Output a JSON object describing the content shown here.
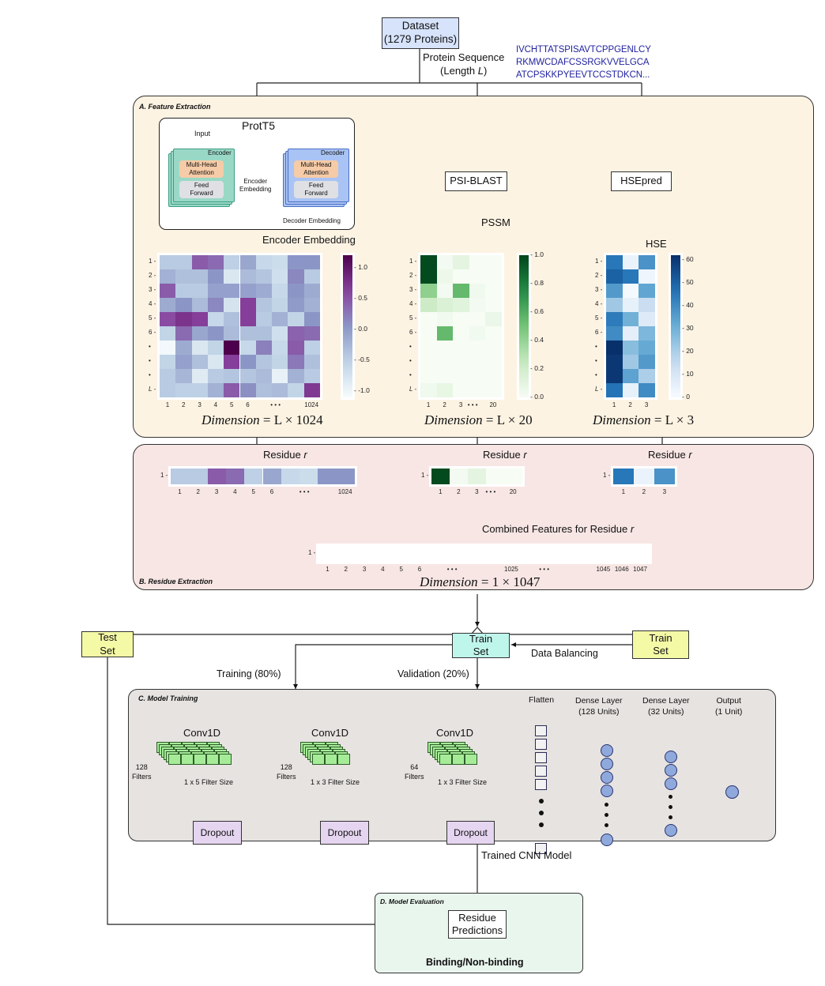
{
  "dataset": {
    "title": "Dataset",
    "subtitle": "(1279 Proteins)"
  },
  "protein_sequence": {
    "label": "Protein Sequence",
    "length_label": "(Length ",
    "length_var": "L",
    "length_close": ")"
  },
  "sequence_lines": [
    "IVCHTTATSPISAVTCPPGENLCY",
    "RKMWCDAFCSSRGKVVELGCA",
    "ATCPSKKPYEEVTCCSTDKCN..."
  ],
  "panel_a": {
    "title": "A. Feature Extraction",
    "prott5": {
      "title": "ProtT5",
      "input": "Input",
      "encoder": "Encoder",
      "decoder": "Decoder",
      "attention": "Multi-Head Attention",
      "attention_l1": "Multi-Head",
      "attention_l2": "Attention",
      "ff_l1": "Feed",
      "ff_l2": "Forward",
      "enc_emb_l1": "Encoder",
      "enc_emb_l2": "Embedding",
      "dec_emb": "Decoder Embedding"
    },
    "encoder_embedding_label": "Encoder Embedding",
    "psiblast": "PSI-BLAST",
    "pssm_label": "PSSM",
    "hsepred": "HSEpred",
    "hse_label": "HSE",
    "dim_encoder": {
      "prefix": "Dimension",
      "eq": "= L × 1024"
    },
    "dim_pssm": {
      "prefix": "Dimension",
      "eq": "= L × 20"
    },
    "dim_hse": {
      "prefix": "Dimension",
      "eq": "= L × 3"
    }
  },
  "panel_b": {
    "title": "B. Residue Extraction",
    "residue_label": "Residue ",
    "residue_var": "r",
    "combined_label": "Combined Features for Residue ",
    "combined_var": "r",
    "concat_symbol": "⊕",
    "dim_combined": {
      "prefix": "Dimension",
      "eq": "= 1 × 1047"
    }
  },
  "split": {
    "test_set": {
      "l1": "Test",
      "l2": "Set"
    },
    "train_set_balanced": {
      "l1": "Train",
      "l2": "Set"
    },
    "train_set_raw": {
      "l1": "Train",
      "l2": "Set"
    },
    "data_balancing": "Data Balancing",
    "training": "Training (80%)",
    "validation": "Validation (20%)"
  },
  "panel_c": {
    "title": "C. Model Training",
    "conv_blocks": [
      {
        "title": "Conv1D",
        "filters": "128",
        "filters_label": "Filters",
        "size": "1 x 5 Filter Size",
        "dropout": "Dropout"
      },
      {
        "title": "Conv1D",
        "filters": "128",
        "filters_label": "Filters",
        "size": "1 x 3 Filter Size",
        "dropout": "Dropout"
      },
      {
        "title": "Conv1D",
        "filters": "64",
        "filters_label": "Filters",
        "size": "1 x 3 Filter Size",
        "dropout": "Dropout"
      }
    ],
    "flatten": "Flatten",
    "dense1": {
      "l1": "Dense Layer",
      "l2": "(128 Units)"
    },
    "dense2": {
      "l1": "Dense Layer",
      "l2": "(32 Units)"
    },
    "output": {
      "l1": "Output",
      "l2": "(1 Unit)"
    }
  },
  "trained_model_label": "Trained CNN Model",
  "panel_d": {
    "title": "D. Model Evaluation",
    "predictions_l1": "Residue",
    "predictions_l2": "Predictions",
    "result": "Binding/Non-binding"
  },
  "colors": {
    "dataset_fill": "#d6e3fb",
    "panel_a_fill": "#fdf3e3",
    "panel_b_fill": "#f7e6e4",
    "panel_c_fill": "#e6e3e1",
    "panel_d_fill": "#e9f6ee",
    "test_set_fill": "#f4f9a6",
    "train_set_fill": "#bff6ec",
    "dropout_fill": "#e5d5f0",
    "encoder_fill": "#9ad8c6",
    "decoder_fill": "#a9c3f4",
    "attention_fill": "#f6cba7",
    "ff_fill": "#dfe0e4",
    "filter_fill": "#a6ec98"
  },
  "heatmaps": {
    "encoder": {
      "row_labels": [
        "1",
        "2",
        "3",
        "4",
        "5",
        "6",
        "•",
        "•",
        "•",
        "L"
      ],
      "col_labels": [
        "1",
        "2",
        "3",
        "4",
        "5",
        "6",
        "",
        "• • •",
        "",
        "1024"
      ],
      "colorbar_ticks": [
        "1.0",
        "0.5",
        "0.0",
        "-0.5",
        "-1.0"
      ],
      "range": [
        -1.1,
        1.2
      ],
      "values": [
        [
          -0.45,
          -0.45,
          0.45,
          0.35,
          -0.5,
          -0.1,
          -0.6,
          -0.65,
          0.05,
          0.05
        ],
        [
          -0.2,
          -0.35,
          -0.35,
          0.05,
          -0.8,
          -0.3,
          -0.4,
          -0.7,
          0.15,
          -0.45
        ],
        [
          0.45,
          -0.45,
          -0.45,
          -0.05,
          -0.05,
          -0.05,
          -0.15,
          -0.6,
          0.05,
          -0.15
        ],
        [
          -0.15,
          0.05,
          -0.3,
          0.15,
          -0.75,
          0.65,
          -0.4,
          -0.55,
          0.0,
          -0.2
        ],
        [
          0.55,
          0.75,
          0.65,
          -0.6,
          -0.35,
          0.65,
          -0.45,
          -0.2,
          -0.55,
          0.05
        ],
        [
          -0.55,
          0.35,
          -0.1,
          0.05,
          -0.3,
          -0.35,
          -0.35,
          -0.7,
          0.4,
          0.35
        ],
        [
          -1.05,
          -0.15,
          -0.8,
          -0.55,
          1.2,
          -0.6,
          0.2,
          -0.6,
          0.45,
          -0.5
        ],
        [
          -0.55,
          -0.05,
          -0.35,
          -0.8,
          0.65,
          0.05,
          -0.4,
          -0.55,
          0.25,
          -0.35
        ],
        [
          -0.45,
          -0.25,
          -0.85,
          -0.45,
          -0.4,
          -0.4,
          -0.3,
          -0.95,
          -0.2,
          -0.45
        ],
        [
          -0.45,
          -0.5,
          -0.5,
          -0.2,
          0.45,
          0.1,
          -0.35,
          -0.3,
          -0.55,
          0.7
        ]
      ]
    },
    "pssm": {
      "row_labels": [
        "1",
        "2",
        "3",
        "4",
        "5",
        "6",
        "•",
        "•",
        "•",
        "L"
      ],
      "col_labels": [
        "1",
        "2",
        "3",
        "• • •",
        "20"
      ],
      "colorbar_ticks": [
        "1.0",
        "0.8",
        "0.6",
        "0.4",
        "0.2",
        "0.0"
      ],
      "range": [
        0,
        1
      ],
      "values": [
        [
          0.98,
          0.02,
          0.1,
          0.0,
          0.0
        ],
        [
          0.98,
          0.05,
          0.0,
          0.0,
          0.0
        ],
        [
          0.42,
          0.02,
          0.55,
          0.04,
          0.0
        ],
        [
          0.22,
          0.15,
          0.12,
          0.02,
          0.0
        ],
        [
          0.0,
          0.03,
          0.0,
          0.0,
          0.06
        ],
        [
          0.0,
          0.55,
          0.0,
          0.03,
          0.0
        ],
        [
          0.0,
          0.0,
          0.0,
          0.0,
          0.0
        ],
        [
          0.0,
          0.0,
          0.0,
          0.0,
          0.0
        ],
        [
          0.0,
          0.0,
          0.0,
          0.0,
          0.0
        ],
        [
          0.04,
          0.08,
          0.0,
          0.0,
          0.0
        ]
      ]
    },
    "hse": {
      "row_labels": [
        "1",
        "2",
        "3",
        "4",
        "5",
        "6",
        "•",
        "•",
        "•",
        "L"
      ],
      "col_labels": [
        "1",
        "2",
        "3"
      ],
      "colorbar_ticks": [
        "60",
        "50",
        "40",
        "30",
        "20",
        "10",
        "0"
      ],
      "range": [
        0,
        62
      ],
      "values": [
        [
          45,
          4,
          38
        ],
        [
          50,
          45,
          3
        ],
        [
          36,
          1,
          33
        ],
        [
          22,
          5,
          14
        ],
        [
          44,
          30,
          8
        ],
        [
          40,
          6,
          28
        ],
        [
          62,
          26,
          32
        ],
        [
          60,
          22,
          36
        ],
        [
          60,
          34,
          20
        ],
        [
          46,
          5,
          40
        ]
      ]
    }
  },
  "residue_vectors": {
    "encoder": {
      "values": [
        -0.45,
        -0.45,
        0.45,
        0.35,
        -0.5,
        -0.1,
        -0.6,
        -0.65,
        0.05,
        0.05
      ],
      "labels": [
        "1",
        "2",
        "3",
        "4",
        "5",
        "6",
        "",
        "• • •",
        "",
        "1024"
      ]
    },
    "pssm": {
      "values": [
        0.98,
        0.02,
        0.1,
        0.0,
        0.0
      ],
      "labels": [
        "1",
        "2",
        "3",
        "• • •",
        "20"
      ]
    },
    "hse": {
      "values": [
        45,
        4,
        38
      ],
      "labels": [
        "1",
        "2",
        "3"
      ]
    },
    "combined_labels": [
      "1",
      "2",
      "3",
      "4",
      "5",
      "6",
      "",
      "• • •",
      "",
      "",
      "1025",
      "",
      "• • •",
      "",
      "",
      "1045",
      "1046",
      "1047"
    ],
    "row_label": "1"
  }
}
